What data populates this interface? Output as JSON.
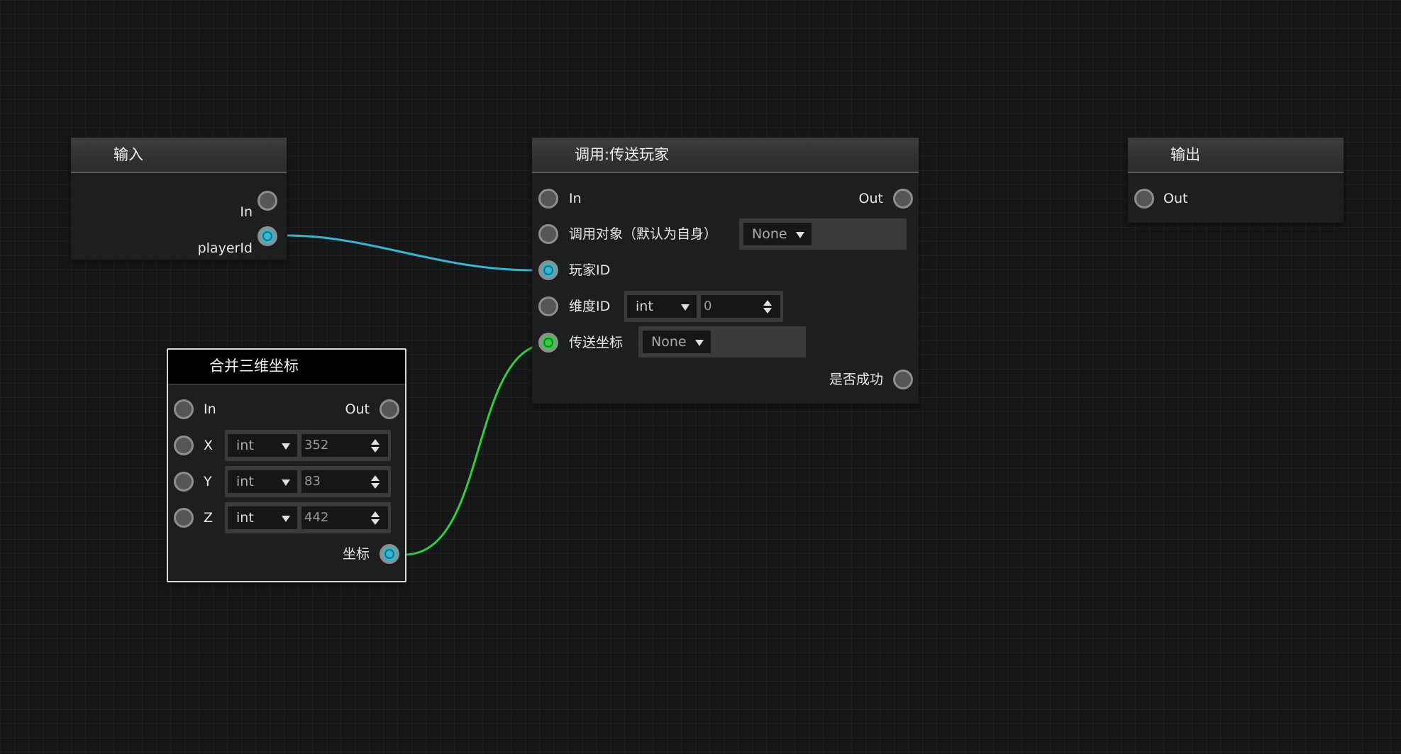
{
  "colors": {
    "background": "#151617",
    "wire_data": "#36b7cf",
    "wire_green": "#2ecf3e",
    "port_connected": "#36b7cf"
  },
  "nodes": {
    "input": {
      "title": "输入",
      "ports": {
        "in": "In",
        "player_id": "playerId"
      }
    },
    "teleport": {
      "title": "调用:传送玩家",
      "ports": {
        "in": "In",
        "out": "Out",
        "target": "调用对象（默认为自身）",
        "player_id": "玩家ID",
        "dimension_id": "维度ID",
        "position": "传送坐标",
        "success": "是否成功"
      },
      "target_select": "None",
      "dimension_type": "int",
      "dimension_value": "0",
      "position_select": "None"
    },
    "output": {
      "title": "输出",
      "ports": {
        "out": "Out"
      }
    },
    "combine": {
      "title": "合并三维坐标",
      "ports": {
        "in": "In",
        "out": "Out",
        "x": "X",
        "y": "Y",
        "z": "Z",
        "coord": "坐标"
      },
      "x_type": "int",
      "x_value": "352",
      "y_type": "int",
      "y_value": "83",
      "z_type": "int",
      "z_value": "442"
    }
  }
}
